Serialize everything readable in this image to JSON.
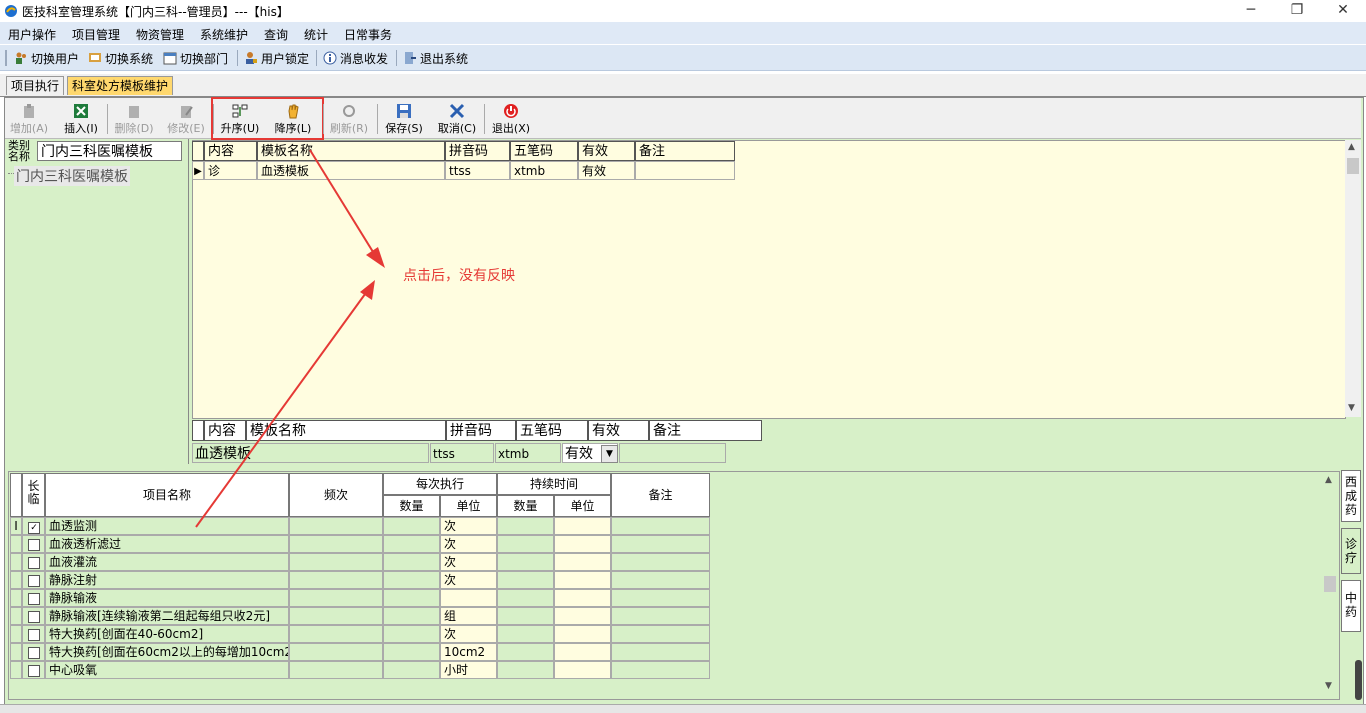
{
  "window": {
    "title": "医技科室管理系统【门内三科--管理员】---【his】"
  },
  "menu": [
    "用户操作",
    "项目管理",
    "物资管理",
    "系统维护",
    "查询",
    "统计",
    "日常事务"
  ],
  "toolbar": [
    "切换用户",
    "切换系统",
    "切换部门",
    "用户锁定",
    "消息收发",
    "退出系统"
  ],
  "tabs": [
    "项目执行",
    "科室处方模板维护"
  ],
  "actions": [
    {
      "label": "增加(A)",
      "icon": "add-icon",
      "enabled": false
    },
    {
      "label": "插入(I)",
      "icon": "excel-icon",
      "enabled": true
    },
    {
      "label": "删除(D)",
      "icon": "delete-icon",
      "enabled": false
    },
    {
      "label": "修改(E)",
      "icon": "edit-icon",
      "enabled": false
    },
    {
      "label": "升序(U)",
      "icon": "sort-asc-icon",
      "enabled": true
    },
    {
      "label": "降序(L)",
      "icon": "hand-icon",
      "enabled": true
    },
    {
      "label": "刷新(R)",
      "icon": "refresh-icon",
      "enabled": false
    },
    {
      "label": "保存(S)",
      "icon": "save-icon",
      "enabled": true
    },
    {
      "label": "取消(C)",
      "icon": "cancel-icon",
      "enabled": true
    },
    {
      "label": "退出(X)",
      "icon": "power-icon",
      "enabled": true
    }
  ],
  "category": {
    "label": "类别名称",
    "value": "门内三科医嘱模板",
    "tree_node": "门内三科医嘱模板"
  },
  "template_grid": {
    "columns": [
      "内容",
      "模板名称",
      "拼音码",
      "五笔码",
      "有效",
      "备注"
    ],
    "rows": [
      [
        "诊",
        "血透模板",
        "ttss",
        "xtmb",
        "有效",
        ""
      ]
    ]
  },
  "edit_form": {
    "columns": [
      "内容",
      "模板名称",
      "拼音码",
      "五笔码",
      "有效",
      "备注"
    ],
    "values": {
      "name": "血透模板",
      "pinyin": "ttss",
      "wubi": "xtmb",
      "valid": "有效"
    }
  },
  "annotation": "点击后，没有反映",
  "items_grid": {
    "headers": {
      "long_term": "长临",
      "name": "项目名称",
      "freq": "频次",
      "per_exec": "每次执行",
      "duration": "持续时间",
      "qty": "数量",
      "unit": "单位",
      "dur_qty": "数量",
      "dur_unit": "单位",
      "note": "备注"
    },
    "rows": [
      {
        "checked": true,
        "name": "血透监测",
        "unit": "次"
      },
      {
        "checked": false,
        "name": "血液透析滤过",
        "unit": "次"
      },
      {
        "checked": false,
        "name": "血液灌流",
        "unit": "次"
      },
      {
        "checked": false,
        "name": "静脉注射",
        "unit": "次"
      },
      {
        "checked": false,
        "name": "静脉输液",
        "unit": ""
      },
      {
        "checked": false,
        "name": "静脉输液[连续输液第二组起每组只收2元]",
        "unit": "组"
      },
      {
        "checked": false,
        "name": "特大换药[创面在40-60cm2]",
        "unit": "次"
      },
      {
        "checked": false,
        "name": "特大换药[创面在60cm2以上的每增加10cm2",
        "unit": "10cm2"
      },
      {
        "checked": false,
        "name": "中心吸氧",
        "unit": "小时"
      }
    ]
  },
  "side_tabs": [
    "西成药",
    "诊疗",
    "中药"
  ],
  "colors": {
    "panel_green": "#d7f0c8",
    "grid_yellow": "#fffde0",
    "active_tab": "#ffd86e",
    "annotation_red": "#e53935"
  }
}
